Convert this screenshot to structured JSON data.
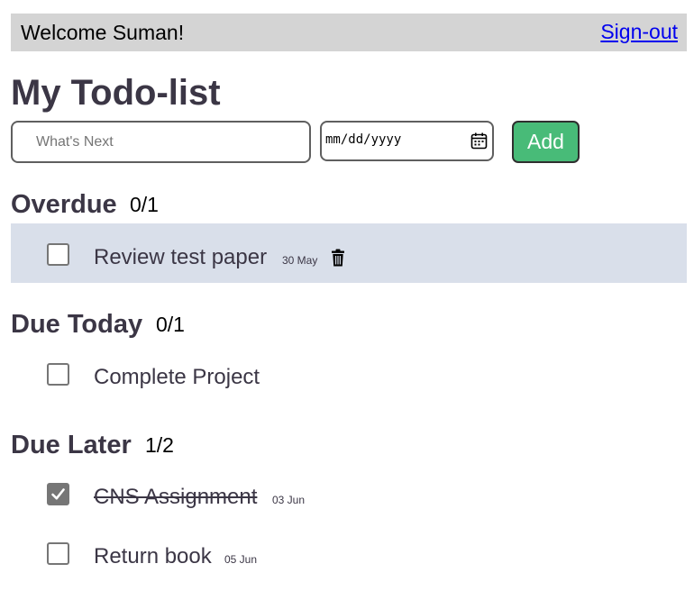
{
  "header": {
    "welcome": "Welcome Suman!",
    "signout": "Sign-out"
  },
  "page_title": "My Todo-list",
  "form": {
    "todo_placeholder": "What's Next",
    "date_value": "mm/dd/yyyy",
    "add_label": "Add"
  },
  "colors": {
    "header_bg": "#d4d4d4",
    "add_button": "#48bb78",
    "overdue_row_bg": "#d9dfea",
    "link": "#0000ee"
  },
  "sections": {
    "overdue": {
      "title": "Overdue",
      "count": "0/1",
      "items": [
        {
          "text": "Review test paper",
          "date": "30 May",
          "done": false
        }
      ]
    },
    "today": {
      "title": "Due Today",
      "count": "0/1",
      "items": [
        {
          "text": "Complete Project",
          "done": false
        }
      ]
    },
    "later": {
      "title": "Due Later",
      "count": "1/2",
      "items": [
        {
          "text": "CNS Assignment",
          "date": "03 Jun",
          "done": true
        },
        {
          "text": "Return book",
          "date": "05 Jun",
          "done": false
        }
      ]
    }
  }
}
